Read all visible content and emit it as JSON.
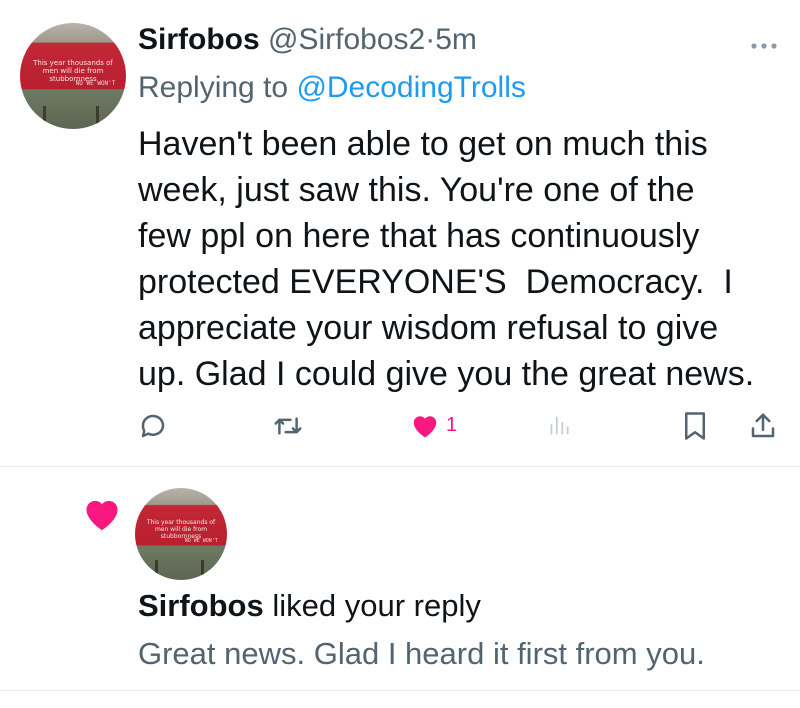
{
  "tweet": {
    "display_name": "Sirfobos",
    "handle": "@Sirfobos2",
    "separator": "·",
    "time": "5m",
    "more_icon": "more-horizontal-icon",
    "replying_prefix": "Replying to",
    "replying_to": "@DecodingTrolls",
    "body_lines": [
      "Haven't been able to get on much this",
      "week, just saw this. You're one of the",
      "few ppl on here that has continuously",
      "protected EVERYONE'S  Democracy.  I",
      "appreciate your wisdom refusal to give",
      "up. Glad I could give you the great news."
    ],
    "avatar_banner_text": "This year thousands of men will die from stubbornness",
    "avatar_banner_note": "NO WE WON'T",
    "actions": {
      "reply_icon": "reply-icon",
      "retweet_icon": "retweet-icon",
      "like_icon": "heart-filled-icon",
      "like_count": "1",
      "views_icon": "views-icon",
      "bookmark_icon": "bookmark-icon",
      "share_icon": "share-icon"
    }
  },
  "notification": {
    "icon": "heart-filled-icon",
    "user": "Sirfobos",
    "action_text": " liked your reply",
    "reply_text": "Great news. Glad I heard it first from you.",
    "avatar_banner_text": "This year thousands of men will die from stubbornness",
    "avatar_banner_note": "NO WE WON'T"
  },
  "colors": {
    "like_pink": "#f91880",
    "link_blue": "#1d9bf0",
    "secondary_text": "#536471",
    "icon_gray": "#536471"
  }
}
